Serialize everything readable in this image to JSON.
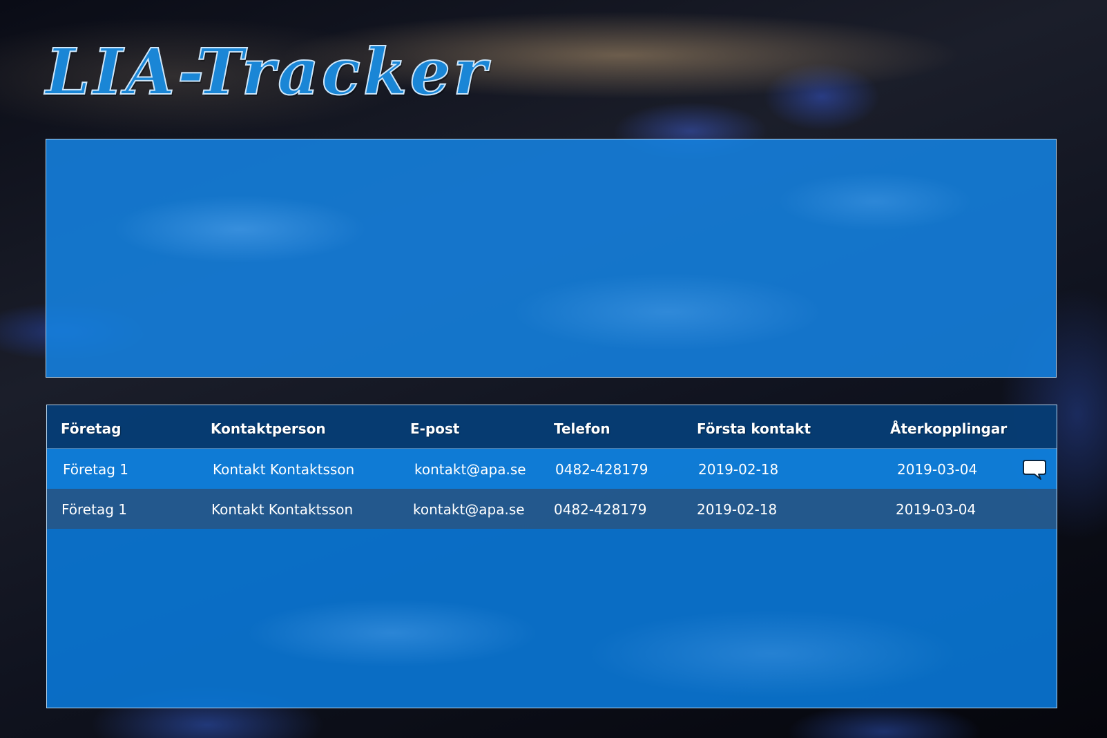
{
  "app": {
    "title": "LIA-Tracker"
  },
  "table": {
    "headers": [
      "Företag",
      "Kontaktperson",
      "E-post",
      "Telefon",
      "Första kontakt",
      "Återkopplingar"
    ],
    "rows": [
      {
        "company": "Företag 1",
        "contact": "Kontakt Kontaktsson",
        "email": "kontakt@apa.se",
        "phone": "0482-428179",
        "first_contact": "2019-02-18",
        "feedback": "2019-03-04",
        "icon": "comment-icon"
      },
      {
        "company": "Företag 1",
        "contact": "Kontakt Kontaktsson",
        "email": "kontakt@apa.se",
        "phone": "0482-428179",
        "first_contact": "2019-02-18",
        "feedback": "2019-03-04"
      }
    ]
  },
  "colors": {
    "title": "#1a86d6",
    "panel": "#1482e1",
    "header_row": "#052d5a",
    "alt_row": "#285582"
  }
}
